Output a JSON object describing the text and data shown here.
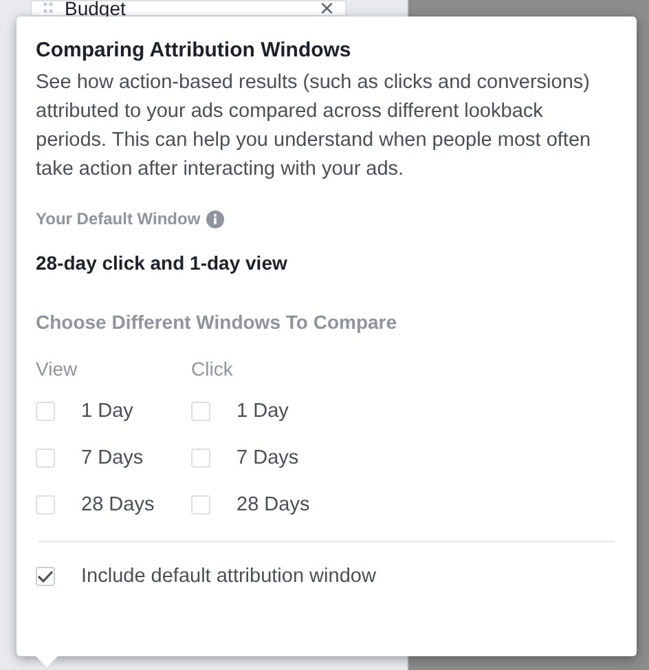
{
  "background_chip": {
    "label": "Budget",
    "close": "×"
  },
  "popover": {
    "title": "Comparing Attribution Windows",
    "description": "See how action-based results (such as clicks and conversions) attributed to your ads compared across different lookback periods. This can help you understand when people most often take action after interacting with your ads.",
    "default_window": {
      "label": "Your Default Window",
      "value": "28-day click and 1-day view"
    },
    "compare": {
      "heading": "Choose Different Windows To Compare",
      "columns": [
        {
          "header": "View",
          "options": [
            {
              "label": "1 Day",
              "checked": false
            },
            {
              "label": "7 Days",
              "checked": false
            },
            {
              "label": "28 Days",
              "checked": false
            }
          ]
        },
        {
          "header": "Click",
          "options": [
            {
              "label": "1 Day",
              "checked": false
            },
            {
              "label": "7 Days",
              "checked": false
            },
            {
              "label": "28 Days",
              "checked": false
            }
          ]
        }
      ]
    },
    "include_default": {
      "label": "Include default attribution window",
      "checked": true
    }
  }
}
